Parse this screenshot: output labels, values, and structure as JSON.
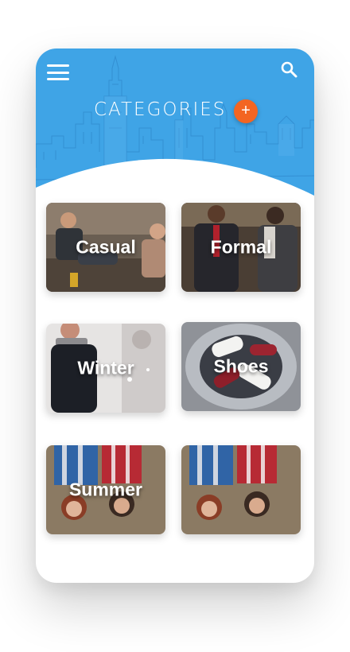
{
  "header": {
    "title": "CATEGORIES",
    "add_label": "+",
    "background_color": "#3fa4e6",
    "accent_color": "#f36522",
    "menu_icon": "hamburger-menu-icon",
    "search_icon": "search-icon"
  },
  "categories": [
    {
      "label": "Casual"
    },
    {
      "label": "Formal"
    },
    {
      "label": "Winter"
    },
    {
      "label": "Shoes"
    },
    {
      "label": "Summer"
    },
    {
      "label": ""
    }
  ]
}
